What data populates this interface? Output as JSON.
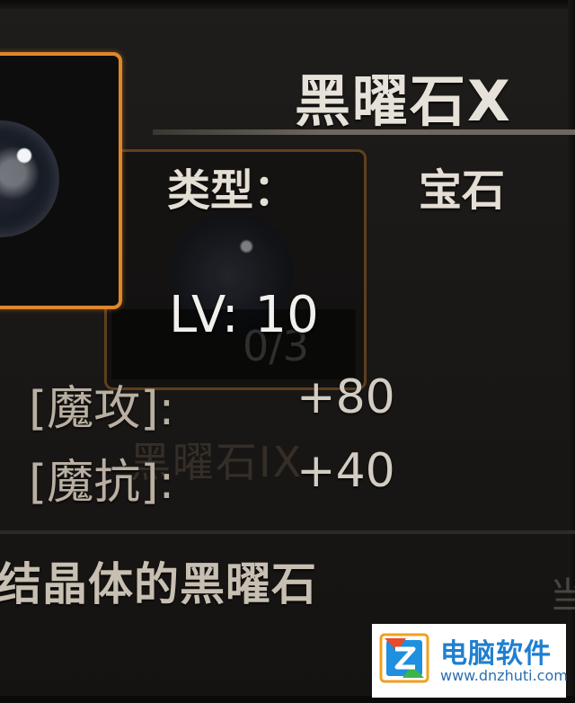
{
  "item": {
    "name": "黑曜石X",
    "type_label": "类型：",
    "type_value": "宝石",
    "level": "LV: 10",
    "stats": [
      {
        "label": "[魔攻]:",
        "value": "+80"
      },
      {
        "label": "[魔抗]:",
        "value": "+40"
      }
    ],
    "description": "结晶体的黑曜石"
  },
  "background_item": {
    "count": "0/3",
    "name": "黑曜石IX"
  },
  "side_glyph": "当",
  "watermark": {
    "title": "电脑软件",
    "url": "www.dnzhuti.com"
  },
  "colors": {
    "slot_border": "#e0862a",
    "text_main": "#e7e2d9",
    "text_stat": "#b9afa2",
    "watermark_blue": "#1f7fd0"
  },
  "icons": {
    "main_gem": "obsidian-gem-icon",
    "ghost_gem": "obsidian-gem-icon",
    "watermark_logo": "z-logo-icon"
  }
}
